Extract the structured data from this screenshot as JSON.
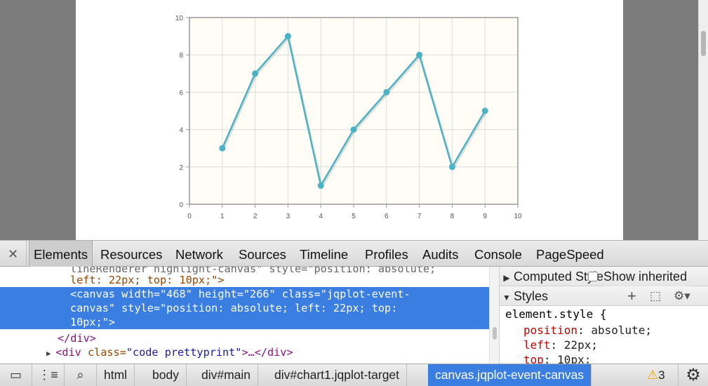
{
  "chart_data": {
    "type": "line",
    "x": [
      1,
      2,
      3,
      4,
      5,
      6,
      7,
      8,
      9
    ],
    "series": [
      {
        "values": [
          3,
          7,
          9,
          1,
          4,
          6,
          8,
          2,
          5
        ],
        "color": "#4bb2c5"
      }
    ],
    "xlim": [
      0,
      10
    ],
    "ylim": [
      0,
      10
    ],
    "xticks": [
      "0",
      "1",
      "2",
      "3",
      "4",
      "5",
      "6",
      "7",
      "8",
      "9",
      "10"
    ],
    "yticks": [
      "0",
      "2",
      "4",
      "6",
      "8",
      "10"
    ],
    "grid": true,
    "background": "#fffdf6",
    "title": "",
    "xlabel": "",
    "ylabel": ""
  },
  "devtools": {
    "close_icon": "close-icon",
    "tabs": [
      {
        "label": "Elements",
        "active": true
      },
      {
        "label": "Resources"
      },
      {
        "label": "Network"
      },
      {
        "label": "Sources"
      },
      {
        "label": "Timeline"
      },
      {
        "label": "Profiles"
      },
      {
        "label": "Audits"
      },
      {
        "label": "Console"
      },
      {
        "label": "PageSpeed"
      }
    ],
    "dom": {
      "cut_line": "lineRenderer highlight-canvas\" style=\"position: absolute;",
      "cut_line2": "left: 22px; top: 10px;\">",
      "selected": {
        "tag_open": "<canvas",
        "attr1": " width=",
        "val1": "\"468\"",
        "attr2": " height=",
        "val2": "\"266\"",
        "attr3": " class=",
        "val3": "\"jqplot-event-",
        "val3b": "canvas\"",
        "attr4": " style=",
        "val4": "\"position: absolute; left: 22px; top:",
        "val4b": "10px;\"",
        "close": ">"
      },
      "close_div": "</div>",
      "next_tag": "<div",
      "next_attr": " class=",
      "next_val": "\"code prettyprint\"",
      "next_rest": ">…</div>"
    },
    "sidebar": {
      "computed_label": "Computed Style",
      "show_inherited_label": "Show inherited",
      "styles_label": "Styles",
      "element_style": "element.style {",
      "props": [
        {
          "name": "position",
          "value": "absolute;"
        },
        {
          "name": "left",
          "value": "22px;"
        },
        {
          "name": "top",
          "value": "10px;"
        }
      ]
    },
    "breadcrumbs": [
      "html",
      "body",
      "div#main",
      "div#chart1.jqplot-target",
      "canvas.jqplot-event-canvas"
    ],
    "warning_count": "3",
    "status_icons": [
      "dock-icon",
      "console-drawer-icon",
      "search-icon",
      "warning-icon",
      "gear-icon"
    ]
  }
}
